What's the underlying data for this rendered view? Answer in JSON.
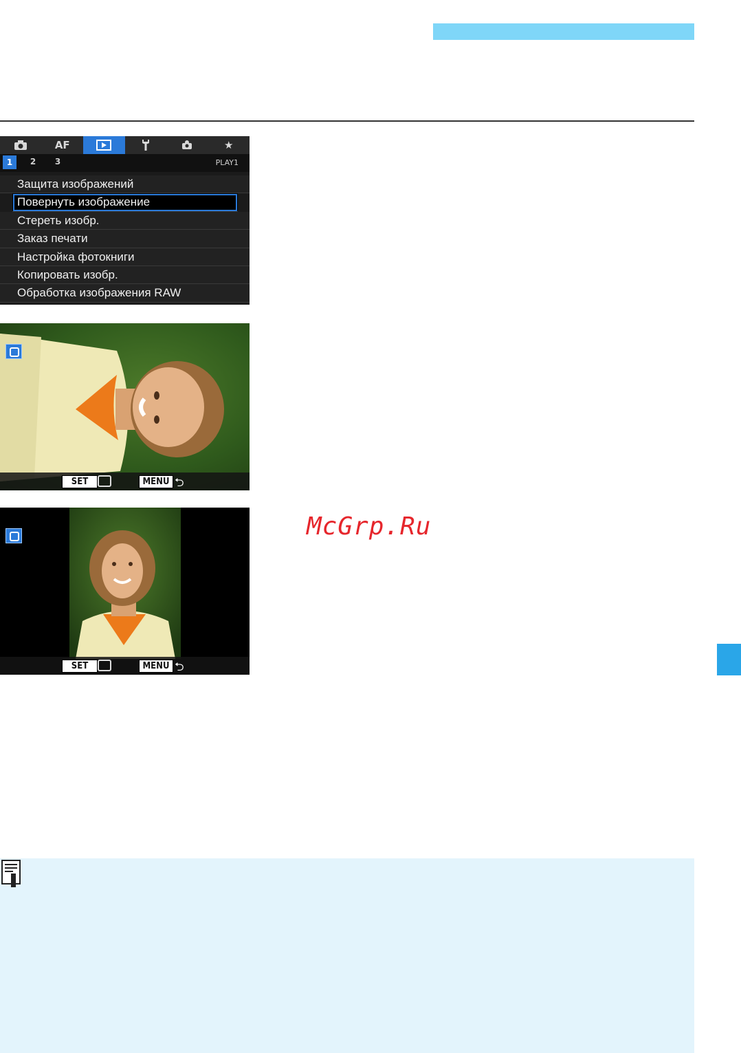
{
  "menu": {
    "tabs": [
      {
        "label": "",
        "icon": "camera-icon"
      },
      {
        "label": "AF",
        "icon": ""
      },
      {
        "label": "",
        "icon": "playback-icon"
      },
      {
        "label": "",
        "icon": "wrench-icon"
      },
      {
        "label": "",
        "icon": "custom-camera-icon"
      },
      {
        "label": "★",
        "icon": "star-icon"
      }
    ],
    "sub_tabs": [
      "1",
      "2",
      "3"
    ],
    "page_id": "PLAY1",
    "items": [
      "Защита изображений",
      "Повернуть изображение",
      "Стереть изобр.",
      "Заказ печати",
      "Настройка фотокниги",
      "Копировать изобр.",
      "Обработка изображения RAW"
    ],
    "selected_index": 1
  },
  "screen1": {
    "set_label": "SET",
    "menu_label": "MENU",
    "back_symbol": "⮌"
  },
  "screen2": {
    "set_label": "SET",
    "menu_label": "MENU",
    "back_symbol": "⮌"
  },
  "watermark": "McGrp.Ru",
  "colors": {
    "header_bar": "#7fd6f8",
    "side_tab": "#2aa6e8",
    "note_bg": "#e3f4fc",
    "accent_blue": "#2b7ad9",
    "watermark": "#e6262c"
  }
}
